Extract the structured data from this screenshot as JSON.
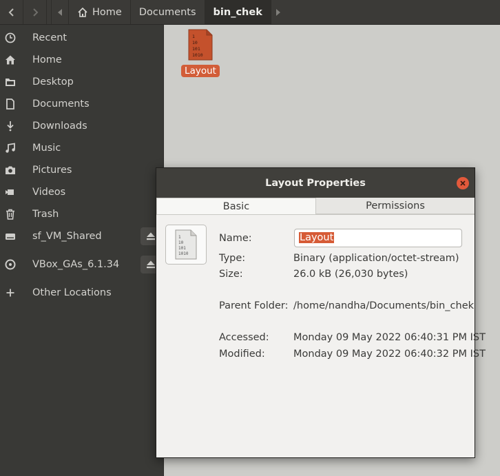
{
  "header": {
    "breadcrumbs": [
      "Home",
      "Documents",
      "bin_chek"
    ]
  },
  "sidebar": {
    "items": [
      {
        "label": "Recent",
        "icon": "clock-icon"
      },
      {
        "label": "Home",
        "icon": "home-icon"
      },
      {
        "label": "Desktop",
        "icon": "folder-icon"
      },
      {
        "label": "Documents",
        "icon": "document-icon"
      },
      {
        "label": "Downloads",
        "icon": "download-icon"
      },
      {
        "label": "Music",
        "icon": "music-icon"
      },
      {
        "label": "Pictures",
        "icon": "camera-icon"
      },
      {
        "label": "Videos",
        "icon": "video-icon"
      },
      {
        "label": "Trash",
        "icon": "trash-icon"
      },
      {
        "label": "sf_VM_Shared",
        "icon": "drive-icon"
      },
      {
        "label": "VBox_GAs_6.1.34",
        "icon": "disc-icon"
      },
      {
        "label": "Other Locations",
        "icon": "plus-icon"
      }
    ]
  },
  "content": {
    "file": {
      "name": "Layout",
      "icon_lines": [
        "1",
        "10",
        "101",
        "1010"
      ]
    }
  },
  "dialog": {
    "title": "Layout Properties",
    "tabs": [
      "Basic",
      "Permissions"
    ],
    "name_label": "Name:",
    "name_value": "Layout",
    "type_label": "Type:",
    "type_value": "Binary (application/octet-stream)",
    "size_label": "Size:",
    "size_value": "26.0 kB (26,030 bytes)",
    "parent_label": "Parent Folder:",
    "parent_value": "/home/nandha/Documents/bin_chek",
    "accessed_label": "Accessed:",
    "accessed_value": "Monday 09 May 2022 06:40:31 PM IST",
    "modified_label": "Modified:",
    "modified_value": "Monday 09 May 2022 06:40:32 PM IST"
  },
  "colors": {
    "accent": "#d25d38",
    "close": "#e2593b",
    "sidebar_bg": "#393936",
    "content_bg": "#cdcdc9"
  }
}
